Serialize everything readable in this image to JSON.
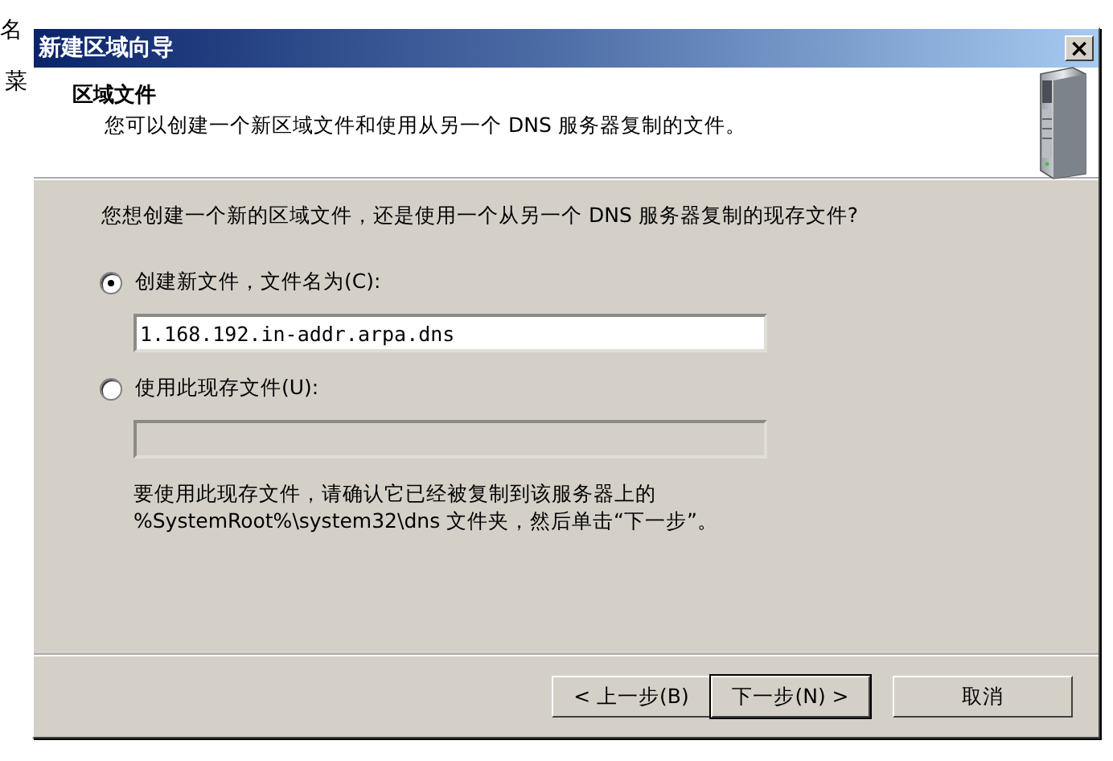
{
  "background": {
    "texts": [
      "名",
      "菜"
    ]
  },
  "window": {
    "title": "新建区域向导",
    "close": "×"
  },
  "header": {
    "title": "区域文件",
    "subtitle": "您可以创建一个新区域文件和使用从另一个 DNS 服务器复制的文件。"
  },
  "question": "您想创建一个新的区域文件，还是使用一个从另一个 DNS 服务器复制的现存文件?",
  "options": [
    {
      "label": "创建新文件，文件名为(C):",
      "selected": true,
      "value": "1.168.192.in-addr.arpa.dns",
      "disabled": false
    },
    {
      "label": "使用此现存文件(U):",
      "selected": false,
      "disabled": true
    }
  ],
  "note": [
    "要使用此现存文件，请确认它已经被复制到该服务器上的",
    "%SystemRoot%\\system32\\dns 文件夹，然后单击“下一步”。"
  ],
  "buttons": [
    {
      "label": "< 上一步(B)",
      "default": false
    },
    {
      "label": "下一步(N) >",
      "default": true
    },
    {
      "label": "取消",
      "default": false
    }
  ]
}
